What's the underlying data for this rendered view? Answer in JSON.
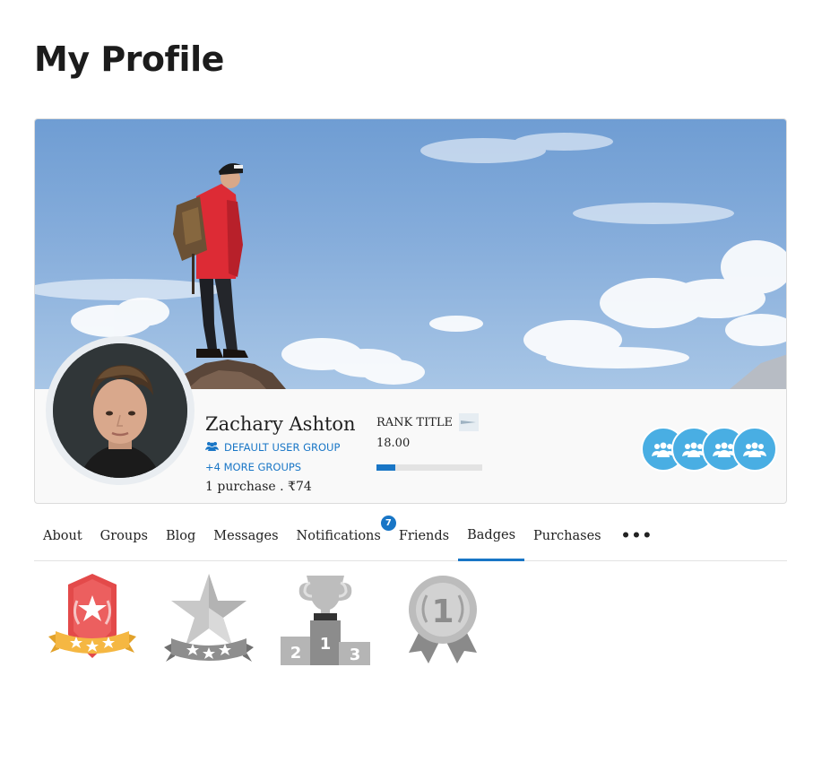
{
  "page": {
    "title": "My Profile"
  },
  "profile": {
    "name": "Zachary Ashton",
    "default_group": "DEFAULT USER GROUP",
    "more_groups": "+4 MORE GROUPS",
    "purchase_info": "1 purchase . ₹74",
    "rank": {
      "title": "RANK TITLE",
      "points": "18.00",
      "progress_fraction": 0.18
    },
    "group_avatar_count": 4
  },
  "tabs": [
    {
      "label": "About",
      "active": false
    },
    {
      "label": "Groups",
      "active": false
    },
    {
      "label": "Blog",
      "active": false
    },
    {
      "label": "Messages",
      "active": false
    },
    {
      "label": "Notifications",
      "active": false,
      "badge": "7"
    },
    {
      "label": "Friends",
      "active": false
    },
    {
      "label": "Badges",
      "active": true
    },
    {
      "label": "Purchases",
      "active": false
    }
  ],
  "more_tabs_label": "•••",
  "badges": [
    {
      "icon": "red-star-shield-badge-icon",
      "earned": true
    },
    {
      "icon": "grey-star-ribbon-badge-icon",
      "earned": false
    },
    {
      "icon": "podium-trophy-badge-icon",
      "earned": false,
      "podium_labels": [
        "2",
        "1",
        "3"
      ]
    },
    {
      "icon": "first-place-medal-badge-icon",
      "earned": false,
      "medal_label": "1"
    }
  ],
  "colors": {
    "accent": "#1976c6",
    "group_avatar": "#49aee3",
    "badge_red": "#e34a4a",
    "badge_gold": "#f5b742",
    "badge_grey": "#9e9e9e"
  }
}
